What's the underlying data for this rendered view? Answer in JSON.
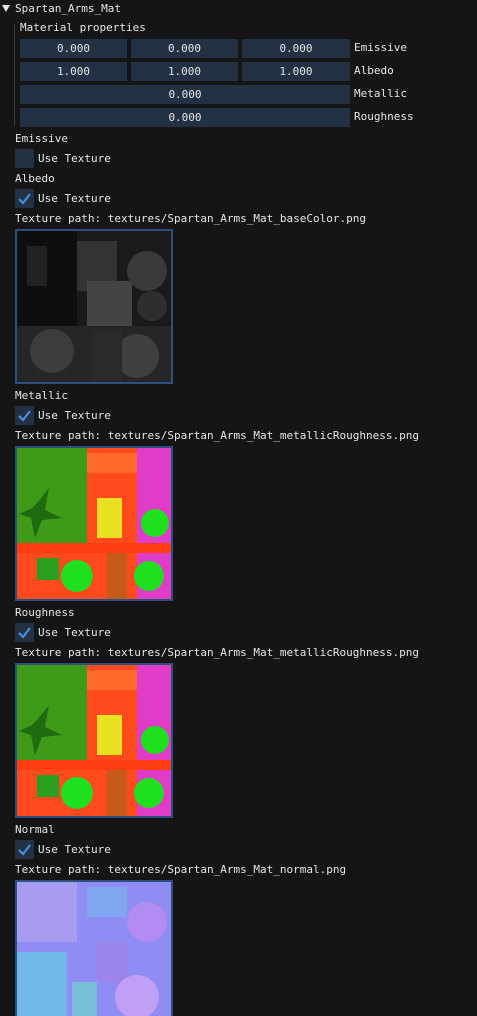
{
  "header": {
    "title": "Spartan_Arms_Mat",
    "subtitle": "Material properties"
  },
  "properties": {
    "emissive": {
      "label": "Emissive",
      "values": [
        "0.000",
        "0.000",
        "0.000"
      ]
    },
    "albedo": {
      "label": "Albedo",
      "values": [
        "1.000",
        "1.000",
        "1.000"
      ]
    },
    "metallic": {
      "label": "Metallic",
      "value": "0.000"
    },
    "roughness": {
      "label": "Roughness",
      "value": "0.000"
    }
  },
  "sections": {
    "emissive": {
      "label": "Emissive",
      "use_texture_label": "Use Texture",
      "checked": false
    },
    "albedo": {
      "label": "Albedo",
      "use_texture_label": "Use Texture",
      "checked": true,
      "texture_path": "Texture path: textures/Spartan_Arms_Mat_baseColor.png"
    },
    "metallic": {
      "label": "Metallic",
      "use_texture_label": "Use Texture",
      "checked": true,
      "texture_path": "Texture path: textures/Spartan_Arms_Mat_metallicRoughness.png"
    },
    "roughness": {
      "label": "Roughness",
      "use_texture_label": "Use Texture",
      "checked": true,
      "texture_path": "Texture path: textures/Spartan_Arms_Mat_metallicRoughness.png"
    },
    "normal": {
      "label": "Normal",
      "use_texture_label": "Use Texture",
      "checked": true,
      "texture_path": "Texture path: textures/Spartan_Arms_Mat_normal.png"
    }
  },
  "colors": {
    "background": "#151515",
    "field_bg": "#233144",
    "accent": "#4a8ee0",
    "image_border": "#2d4f7e"
  },
  "icons": {
    "tree_toggle": "triangle-down-icon",
    "checkbox": "checkmark-icon"
  }
}
